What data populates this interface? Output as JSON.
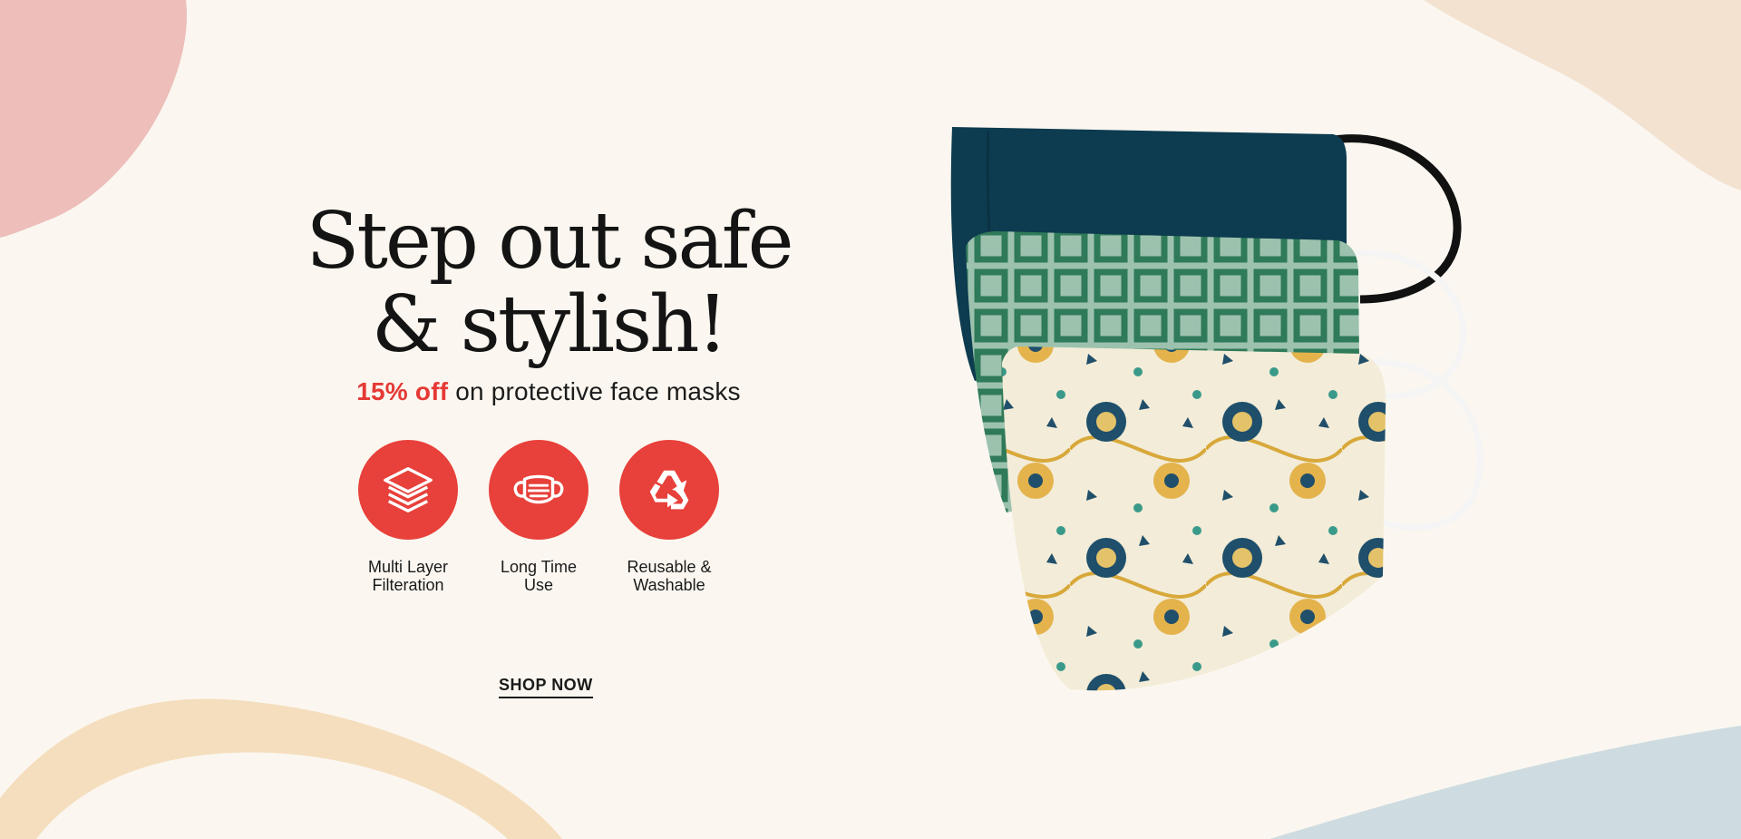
{
  "hero": {
    "headline_line1": "Step out safe",
    "headline_line2": "& stylish!",
    "discount": "15% off",
    "subtitle_rest": " on protective face masks"
  },
  "features": [
    {
      "icon": "layers-icon",
      "label_line1": "Multi Layer",
      "label_line2": "Filteration"
    },
    {
      "icon": "face-mask-icon",
      "label_line1": "Long Time",
      "label_line2": "Use"
    },
    {
      "icon": "recycle-icon",
      "label_line1": "Reusable &",
      "label_line2": "Washable"
    }
  ],
  "cta": {
    "label": "SHOP NOW"
  },
  "colors": {
    "background": "#fbf7f0",
    "accent_red": "#e8403a",
    "text_dark": "#141414",
    "mask_navy": "#0d3b4f",
    "mask_green": "#2f7a58",
    "mask_floral_base": "#f3ecd8"
  }
}
